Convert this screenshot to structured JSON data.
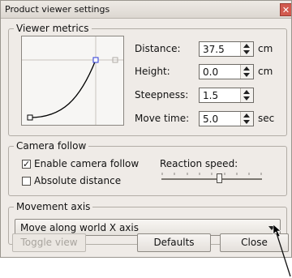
{
  "window": {
    "title": "Product viewer settings",
    "close_symbol": "✕"
  },
  "viewer_metrics": {
    "legend": "Viewer metrics",
    "distance": {
      "label": "Distance:",
      "value": "37.5",
      "unit": "cm"
    },
    "height": {
      "label": "Height:",
      "value": "0.0",
      "unit": "cm"
    },
    "steepness": {
      "label": "Steepness:",
      "value": "1.5",
      "unit": ""
    },
    "move_time": {
      "label": "Move time:",
      "value": "5.0",
      "unit": "sec"
    }
  },
  "camera_follow": {
    "legend": "Camera follow",
    "enable_label": "Enable camera follow",
    "enable_checked": true,
    "absolute_label": "Absolute distance",
    "absolute_checked": false,
    "reaction_label": "Reaction speed:",
    "reaction_value": 0.58
  },
  "movement_axis": {
    "legend": "Movement axis",
    "selected": "Move along world X axis"
  },
  "buttons": {
    "toggle_view": "Toggle view",
    "defaults": "Defaults",
    "close": "Close"
  },
  "icons": {
    "cursor": "mouse-pointer-icon",
    "combo_arrow": "chevron-down-icon",
    "spin": "spin-arrows-icon"
  }
}
